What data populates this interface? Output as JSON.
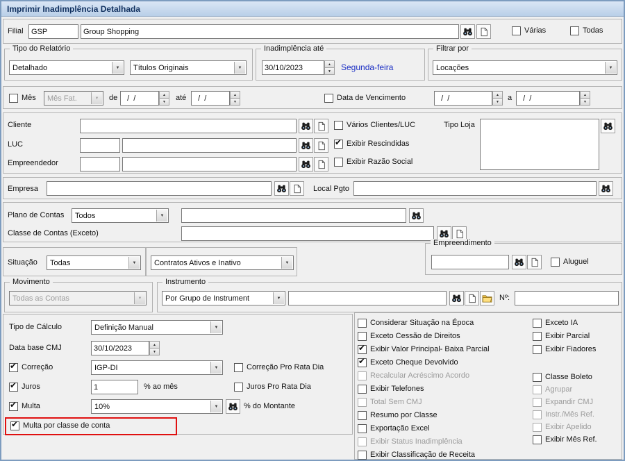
{
  "window": {
    "title": "Imprimir Inadimplência Detalhada"
  },
  "filial": {
    "label": "Filial",
    "code": "GSP",
    "name": "Group Shopping",
    "varias": {
      "label": "Várias",
      "checked": false
    },
    "todas": {
      "label": "Todas",
      "checked": false
    }
  },
  "tipo_relatorio": {
    "legend": "Tipo do Relatório",
    "formato": "Detalhado",
    "titulos": "Títulos Originais"
  },
  "inadimplencia_ate": {
    "legend": "Inadimplência até",
    "date": "30/10/2023",
    "weekday": "Segunda-feira"
  },
  "filtrar_por": {
    "legend": "Filtrar por",
    "value": "Locações"
  },
  "mes": {
    "cb": {
      "label": "Mês",
      "checked": false
    },
    "fat_value": "Mês Fat.",
    "de_label": "de",
    "de_date": "  /  /",
    "ate_label": "até",
    "ate_date": "  /  /",
    "vencimento": {
      "label": "Data de Vencimento",
      "checked": false
    },
    "venc_de_date": "  /  /",
    "a_label": "a",
    "venc_a_date": "  /  /"
  },
  "cliente": {
    "label": "Cliente",
    "luc_label": "LUC",
    "empreendedor_label": "Empreendedor",
    "varios": {
      "label": "Vários Clientes/LUC",
      "checked": false
    },
    "rescindidas": {
      "label": "Exibir Rescindidas",
      "checked": true
    },
    "razao_social": {
      "label": "Exibir Razão Social",
      "checked": false
    },
    "tipo_loja_label": "Tipo Loja"
  },
  "empresa": {
    "label": "Empresa",
    "local_pgto_label": "Local Pgto"
  },
  "plano": {
    "label": "Plano de Contas",
    "value": "Todos",
    "classe_label": "Classe de Contas (Exceto)"
  },
  "situacao": {
    "label": "Situação",
    "value": "Todas",
    "contratos_value": "Contratos Ativos e Inativo"
  },
  "empreendimento": {
    "legend": "Empreendimento",
    "aluguel": {
      "label": "Aluguel",
      "checked": false
    }
  },
  "movimento": {
    "legend": "Movimento",
    "value": "Todas as Contas"
  },
  "instrumento": {
    "legend": "Instrumento",
    "value": "Por Grupo de Instrument",
    "numero_label": "Nº:"
  },
  "calculo": {
    "tipo_label": "Tipo de Cálculo",
    "tipo_value": "Definição Manual",
    "database_label": "Data base CMJ",
    "database_value": "30/10/2023",
    "correcao": {
      "label": "Correção",
      "checked": true
    },
    "correcao_value": "IGP-DI",
    "correcao_prorata": {
      "label": "Correção Pro Rata Dia",
      "checked": false
    },
    "juros": {
      "label": "Juros",
      "checked": true
    },
    "juros_value": "1",
    "juros_unit": "% ao mês",
    "juros_prorata": {
      "label": "Juros Pro Rata Dia",
      "checked": false
    },
    "multa": {
      "label": "Multa",
      "checked": true
    },
    "multa_value": "10%",
    "multa_unit": "% do Montante",
    "multa_classe": {
      "label": "Multa por classe de conta",
      "checked": true
    }
  },
  "options_mid": [
    {
      "label": "Considerar Situação na Época",
      "checked": false,
      "disabled": false
    },
    {
      "label": "Exceto Cessão de Direitos",
      "checked": false,
      "disabled": false
    },
    {
      "label": "Exibir Valor Principal- Baixa Parcial",
      "checked": true,
      "disabled": false
    },
    {
      "label": "Exceto Cheque Devolvido",
      "checked": true,
      "disabled": false
    },
    {
      "label": "Recalcular Acréscimo Acordo",
      "checked": false,
      "disabled": true
    },
    {
      "label": "Exibir Telefones",
      "checked": false,
      "disabled": false
    },
    {
      "label": "Total Sem CMJ",
      "checked": false,
      "disabled": true
    },
    {
      "label": "Resumo por Classe",
      "checked": false,
      "disabled": false
    },
    {
      "label": "Exportação Excel",
      "checked": false,
      "disabled": false
    },
    {
      "label": "Exibir Status Inadimplência",
      "checked": false,
      "disabled": true
    },
    {
      "label": "Exibir Classificação de Receita",
      "checked": false,
      "disabled": false
    }
  ],
  "options_right": [
    {
      "label": "Exceto IA",
      "checked": false,
      "disabled": false
    },
    {
      "label": "Exibir Parcial",
      "checked": false,
      "disabled": false
    },
    {
      "label": "Exibir Fiadores",
      "checked": false,
      "disabled": false
    },
    {
      "label": "Classe Boleto",
      "checked": false,
      "disabled": false
    },
    {
      "label": "Agrupar",
      "checked": false,
      "disabled": true
    },
    {
      "label": "Expandir CMJ",
      "checked": false,
      "disabled": true
    },
    {
      "label": "Instr./Mês Ref.",
      "checked": false,
      "disabled": true
    },
    {
      "label": "Exibir Apelido",
      "checked": false,
      "disabled": true
    },
    {
      "label": "Exibir Mês Ref.",
      "checked": false,
      "disabled": false
    }
  ],
  "colors": {
    "weekday_text": "#1b2fc4",
    "annotation_highlight": "#e01010",
    "titlebar_top": "#dae6f5",
    "titlebar_bottom": "#b9cfe8"
  }
}
